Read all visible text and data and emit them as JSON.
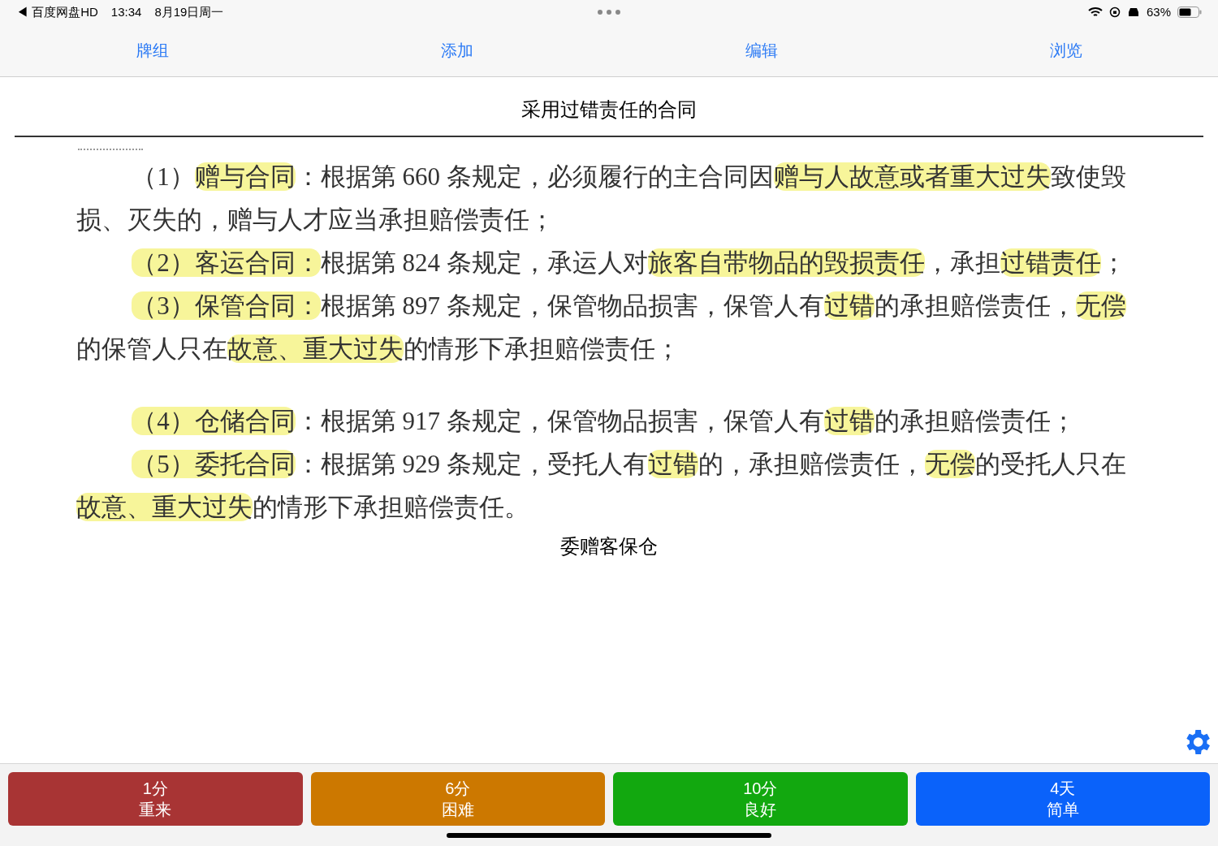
{
  "status_bar": {
    "back_app": "◀ 百度网盘HD",
    "time": "13:34",
    "date": "8月19日周一",
    "battery": "63%"
  },
  "tabs": [
    {
      "label": "牌组"
    },
    {
      "label": "添加"
    },
    {
      "label": "编辑"
    },
    {
      "label": "浏览"
    }
  ],
  "card": {
    "title": "采用过错责任的合同",
    "paragraphs": [
      {
        "segments": [
          {
            "text": "（1）",
            "highlighted": false
          },
          {
            "text": "赠与合同",
            "highlighted": true
          },
          {
            "text": "：根据第 660 条规定，必须履行的主合同因",
            "highlighted": false
          },
          {
            "text": "赠与人故意或者重大过失",
            "highlighted": true
          },
          {
            "text": "致使毁损、灭失的，赠与人才应当承担赔偿责任；",
            "highlighted": false
          }
        ]
      },
      {
        "segments": [
          {
            "text": "（2）客运合同：",
            "highlighted": true
          },
          {
            "text": "根据第 824 条规定，承运人对",
            "highlighted": false
          },
          {
            "text": "旅客自带物品的毁损责任",
            "highlighted": true
          },
          {
            "text": "，承担",
            "highlighted": false
          },
          {
            "text": "过错责任",
            "highlighted": true
          },
          {
            "text": "；",
            "highlighted": false
          }
        ]
      },
      {
        "segments": [
          {
            "text": "（3）保管合同：",
            "highlighted": true
          },
          {
            "text": "根据第 897 条规定，保管物品损害，保管人有",
            "highlighted": false
          },
          {
            "text": "过错",
            "highlighted": true
          },
          {
            "text": "的承担赔偿责任，",
            "highlighted": false
          },
          {
            "text": "无偿",
            "highlighted": true
          },
          {
            "text": "的保管人只在",
            "highlighted": false
          },
          {
            "text": "故意、重大过失",
            "highlighted": true
          },
          {
            "text": "的情形下承担赔偿责任；",
            "highlighted": false
          }
        ]
      },
      {
        "segments": [
          {
            "text": "（4）仓储合同",
            "highlighted": true
          },
          {
            "text": "：根据第 917 条规定，保管物品损害，保管人有",
            "highlighted": false
          },
          {
            "text": "过错",
            "highlighted": true
          },
          {
            "text": "的承担赔偿责任；",
            "highlighted": false
          }
        ]
      },
      {
        "segments": [
          {
            "text": "（5）委托合同",
            "highlighted": true
          },
          {
            "text": "：根据第 929 条规定，受托人有",
            "highlighted": false
          },
          {
            "text": "过错",
            "highlighted": true
          },
          {
            "text": "的，承担赔偿责任，",
            "highlighted": false
          },
          {
            "text": "无偿",
            "highlighted": true
          },
          {
            "text": "的受托人只在",
            "highlighted": false
          },
          {
            "text": "故意、重大过失",
            "highlighted": true
          },
          {
            "text": "的情形下承担赔偿责任。",
            "highlighted": false
          }
        ]
      }
    ],
    "answer": "委赠客保仓"
  },
  "answer_buttons": [
    {
      "kind": "again",
      "interval": "1分",
      "label": "重来"
    },
    {
      "kind": "hard",
      "interval": "6分",
      "label": "困难"
    },
    {
      "kind": "good",
      "interval": "10分",
      "label": "良好"
    },
    {
      "kind": "easy",
      "interval": "4天",
      "label": "简单"
    }
  ]
}
